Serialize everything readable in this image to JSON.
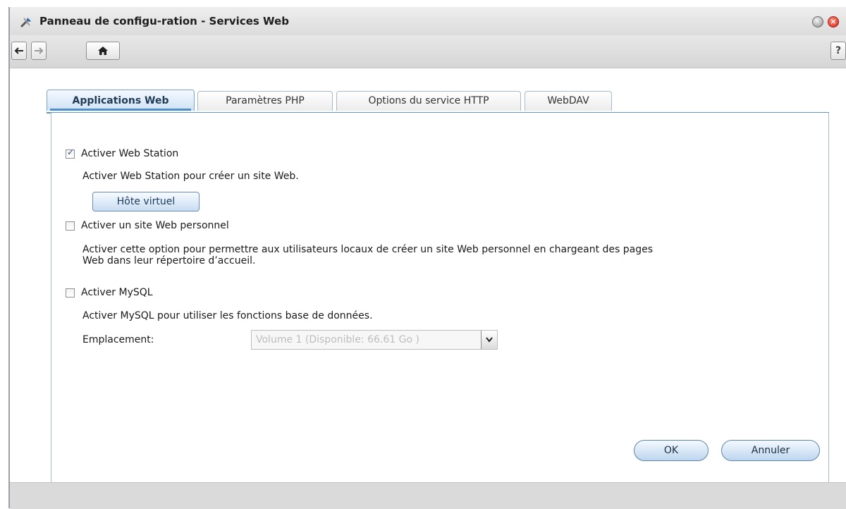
{
  "window": {
    "title": "Panneau de configu-ration - Services Web"
  },
  "toolbar": {
    "back_icon": "back-arrow-icon",
    "forward_icon": "forward-arrow-icon",
    "home_icon": "home-icon",
    "help_label": "?"
  },
  "tabs": [
    {
      "label": "Applications Web",
      "active": true
    },
    {
      "label": "Paramètres PHP",
      "active": false
    },
    {
      "label": "Options du service HTTP",
      "active": false
    },
    {
      "label": "WebDAV",
      "active": false
    }
  ],
  "web_station": {
    "checkbox_label": "Activer Web Station",
    "checked": true,
    "description": "Activer Web Station pour créer un site Web.",
    "virtual_host_button": "Hôte virtuel"
  },
  "personal_site": {
    "checkbox_label": "Activer un site Web personnel",
    "checked": false,
    "description_line1": "Activer cette option pour permettre aux utilisateurs locaux de créer un site Web personnel en chargeant des pages",
    "description_line2": "Web dans leur répertoire d’accueil."
  },
  "mysql": {
    "checkbox_label": "Activer MySQL",
    "checked": false,
    "description": "Activer MySQL pour utiliser les fonctions base de données.",
    "location_label": "Emplacement:",
    "location_value": "Volume 1 (Disponible: 66.61 Go )"
  },
  "actions": {
    "ok_label": "OK",
    "cancel_label": "Annuler"
  },
  "colors": {
    "accent": "#4e8ec8",
    "tab_border": "#7fa3c3",
    "close_red": "#d3261b"
  }
}
